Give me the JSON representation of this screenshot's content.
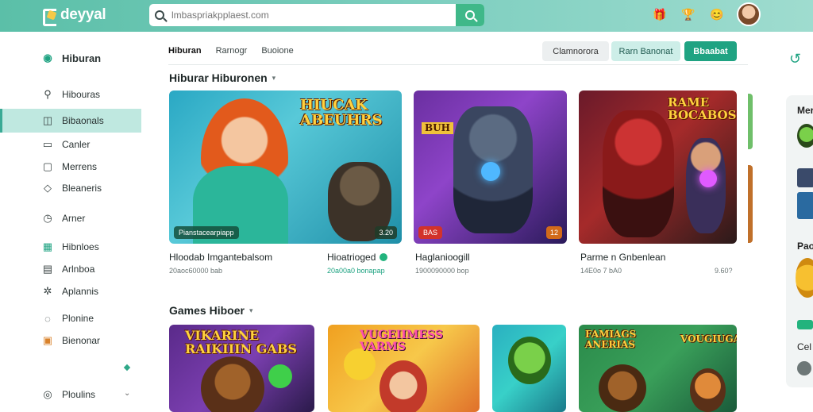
{
  "app": {
    "logo_text": "deyyal"
  },
  "search": {
    "placeholder": "lmbaspriakpplaest.com"
  },
  "sidebar": {
    "header": "Hiburan",
    "items": [
      {
        "label": "Hibouras",
        "icon": "user-icon"
      },
      {
        "label": "Bibaonals",
        "icon": "gamepad-icon",
        "active": true
      },
      {
        "label": "Canler",
        "icon": "calendar-icon"
      },
      {
        "label": "Merrens",
        "icon": "chat-icon"
      },
      {
        "label": "Bleaneris",
        "icon": "shield-icon"
      },
      {
        "label": "Arner",
        "icon": "clock-icon"
      },
      {
        "label": "Hibnloes",
        "icon": "grid-icon"
      },
      {
        "label": "Arlnboa",
        "icon": "tag-icon"
      },
      {
        "label": "Aplannis",
        "icon": "settings-icon"
      },
      {
        "label": "Plonine",
        "icon": "chat-bubble-icon"
      },
      {
        "label": "Bienonar",
        "icon": "wallet-icon"
      },
      {
        "label": "Ploulins",
        "icon": "headset-icon"
      }
    ]
  },
  "main": {
    "tabs": [
      "Hiburan",
      "Rarnogr",
      "Buoione"
    ],
    "actions": {
      "a": "Clamnorora",
      "b": "Rarn Banonat",
      "c": "Bbaabat"
    },
    "section1": {
      "title": "Hiburar Hiburonen",
      "cards": [
        {
          "art_title": "HIUCAK ABEUHRS",
          "badge": "Pianstacearpiapp",
          "badge2": "3.20",
          "name": "Hloodab Imgantebalsom",
          "sub": "20aoc60000 bab"
        },
        {
          "art_title": "BUH",
          "badge": "BAS",
          "badge2": "12",
          "name": "Hioatrioged",
          "sub": "20a00a0 bonapap",
          "verified": true
        },
        {
          "art_title": "",
          "badge": "",
          "badge2": "",
          "name": "Haglanioogill",
          "sub": "1900090000 bop"
        },
        {
          "art_title": "RAME BOCABOS",
          "badge": "",
          "badge2": "",
          "name": "Parme n Gnbenlean",
          "sub": "14E0o 7 bA0",
          "sub2": "9.60?"
        }
      ]
    },
    "section2": {
      "title": "Games Hiboer",
      "cards": [
        {
          "art_title": "VIKARINE RAIKIIIN GABS"
        },
        {
          "art_title": "VUGEIIMESS VARMS"
        },
        {
          "art_title": ""
        },
        {
          "art_title": "FAMIAGS ANERIAS"
        },
        {
          "art_title": "VOUGIUGA"
        }
      ]
    }
  },
  "right_panel": {
    "t1": "Mer",
    "t2": "Pao",
    "t3": "Cel"
  },
  "colors": {
    "brand": "#5bbfa8",
    "accent": "#1fa382",
    "active_bg": "#bfe8e0"
  }
}
